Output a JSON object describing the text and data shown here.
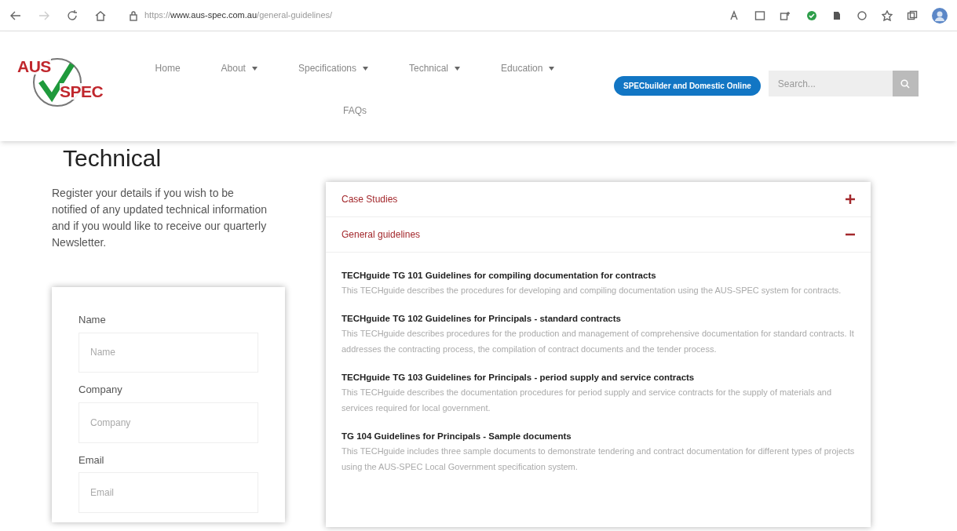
{
  "browser": {
    "url": "https://**www.aus-spec.com.au**/general-guidelines/",
    "forward_disabled": true
  },
  "header": {
    "logo": {
      "top": "AUS",
      "bottom": "SPEC"
    },
    "nav": [
      {
        "label": "Home",
        "dropdown": false
      },
      {
        "label": "About",
        "dropdown": true
      },
      {
        "label": "Specifications",
        "dropdown": true
      },
      {
        "label": "Technical",
        "dropdown": true
      },
      {
        "label": "Education",
        "dropdown": true
      },
      {
        "label": "FAQs",
        "dropdown": false
      }
    ],
    "cta_button": "SPECbuilder and Domestic Online",
    "search": {
      "placeholder": "Search..."
    }
  },
  "page_title": "Technical",
  "intro": "Register your details if you wish to be notified of any updated technical information and if you would like to receive our quarterly Newsletter.",
  "form": {
    "fields": [
      {
        "label": "Name",
        "placeholder": "Name"
      },
      {
        "label": "Company",
        "placeholder": "Company"
      },
      {
        "label": "Email",
        "placeholder": "Email"
      }
    ]
  },
  "accordion": [
    {
      "title": "Case Studies",
      "expanded": false
    },
    {
      "title": "General guidelines",
      "expanded": true,
      "items": [
        {
          "title": "TECHguide TG 101 Guidelines for compiling documentation for contracts",
          "description": "This TECHguide describes the procedures for developing and compiling documentation using the AUS-SPEC system for contracts."
        },
        {
          "title": "TECHguide TG 102 Guidelines for Principals - standard contracts",
          "description": "This TECHguide describes procedures for the production and management of comprehensive documentation for standard contracts. It addresses the contracting process, the compilation of contract documents and the tender process."
        },
        {
          "title": "TECHguide TG 103 Guidelines for Principals - period supply and service contracts",
          "description": "This TECHguide describes the documentation procedures for period supply and service contracts for the supply of materials and services required for local government."
        },
        {
          "title": "TG 104 Guidelines for Principals - Sample documents",
          "description": "This TECHguide includes three sample documents to demonstrate tendering and contract documentation for different types of projects using the AUS-SPEC Local Government specification system."
        }
      ]
    }
  ]
}
